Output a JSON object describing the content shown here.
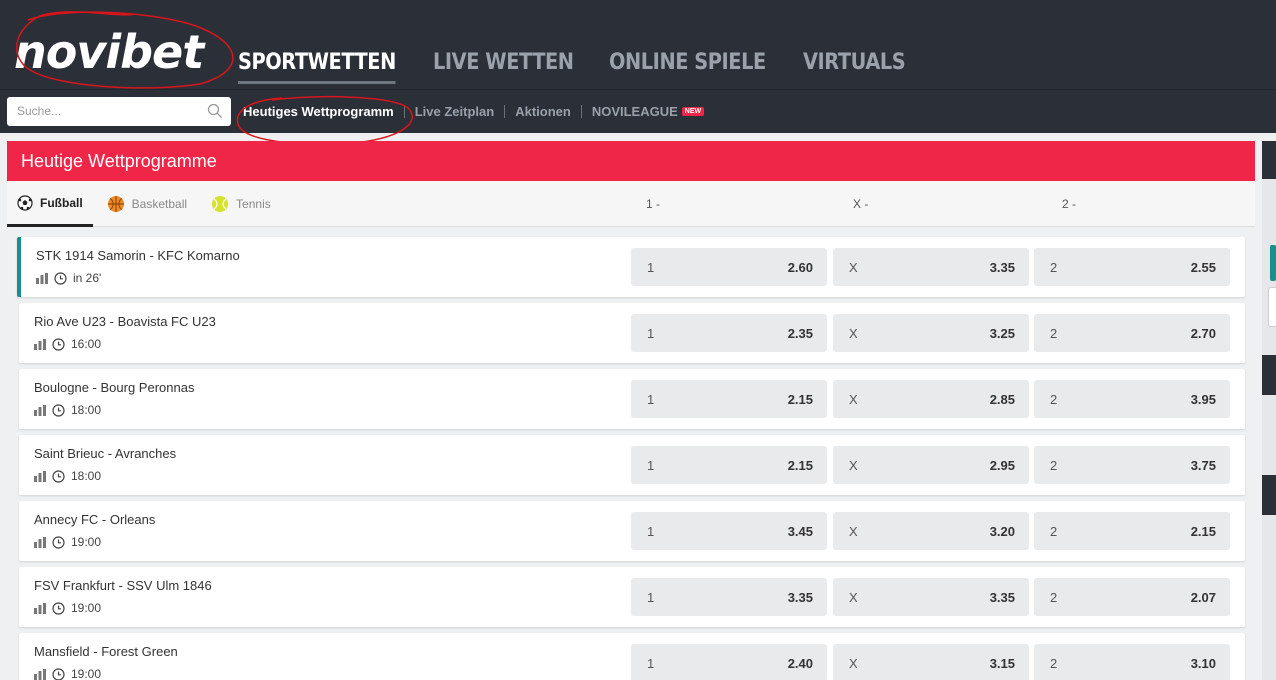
{
  "brand": {
    "logo_text": "novibet"
  },
  "main_nav": [
    {
      "label": "SPORTWETTEN",
      "active": true
    },
    {
      "label": "LIVE WETTEN",
      "active": false
    },
    {
      "label": "ONLINE SPIELE",
      "active": false
    },
    {
      "label": "VIRTUALS",
      "active": false
    }
  ],
  "search": {
    "placeholder": "Suche..."
  },
  "sub_nav": [
    {
      "label": "Heutiges Wettprogramm",
      "active": true
    },
    {
      "label": "Live Zeitplan",
      "active": false
    },
    {
      "label": "Aktionen",
      "active": false
    },
    {
      "label": "NOVILEAGUE",
      "active": false,
      "badge": "NEW"
    }
  ],
  "panel": {
    "title": "Heutige Wettprogramme",
    "sport_tabs": [
      {
        "label": "Fußball",
        "icon": "soccer-ball-icon",
        "active": true
      },
      {
        "label": "Basketball",
        "icon": "basketball-icon",
        "active": false
      },
      {
        "label": "Tennis",
        "icon": "tennis-ball-icon",
        "active": false
      }
    ],
    "columns": [
      "1 -",
      "X -",
      "2 -"
    ]
  },
  "matches": [
    {
      "name": "STK 1914 Samorin - KFC Komarno",
      "time": "in 26'",
      "live": true,
      "odds": [
        {
          "label": "1",
          "value": "2.60"
        },
        {
          "label": "X",
          "value": "3.35"
        },
        {
          "label": "2",
          "value": "2.55"
        }
      ]
    },
    {
      "name": "Rio Ave U23 - Boavista FC U23",
      "time": "16:00",
      "live": false,
      "odds": [
        {
          "label": "1",
          "value": "2.35"
        },
        {
          "label": "X",
          "value": "3.25"
        },
        {
          "label": "2",
          "value": "2.70"
        }
      ]
    },
    {
      "name": "Boulogne - Bourg Peronnas",
      "time": "18:00",
      "live": false,
      "odds": [
        {
          "label": "1",
          "value": "2.15"
        },
        {
          "label": "X",
          "value": "2.85"
        },
        {
          "label": "2",
          "value": "3.95"
        }
      ]
    },
    {
      "name": "Saint Brieuc - Avranches",
      "time": "18:00",
      "live": false,
      "odds": [
        {
          "label": "1",
          "value": "2.15"
        },
        {
          "label": "X",
          "value": "2.95"
        },
        {
          "label": "2",
          "value": "3.75"
        }
      ]
    },
    {
      "name": "Annecy FC - Orleans",
      "time": "19:00",
      "live": false,
      "odds": [
        {
          "label": "1",
          "value": "3.45"
        },
        {
          "label": "X",
          "value": "3.20"
        },
        {
          "label": "2",
          "value": "2.15"
        }
      ]
    },
    {
      "name": "FSV Frankfurt - SSV Ulm 1846",
      "time": "19:00",
      "live": false,
      "odds": [
        {
          "label": "1",
          "value": "3.35"
        },
        {
          "label": "X",
          "value": "3.35"
        },
        {
          "label": "2",
          "value": "2.07"
        }
      ]
    },
    {
      "name": "Mansfield - Forest Green",
      "time": "19:00",
      "live": false,
      "odds": [
        {
          "label": "1",
          "value": "2.40"
        },
        {
          "label": "X",
          "value": "3.15"
        },
        {
          "label": "2",
          "value": "3.10"
        }
      ]
    }
  ],
  "colors": {
    "accent": "#ef2648",
    "header_bg": "#2b3038",
    "live_marker": "#1a8e8c",
    "annotation": "#d8151b"
  }
}
